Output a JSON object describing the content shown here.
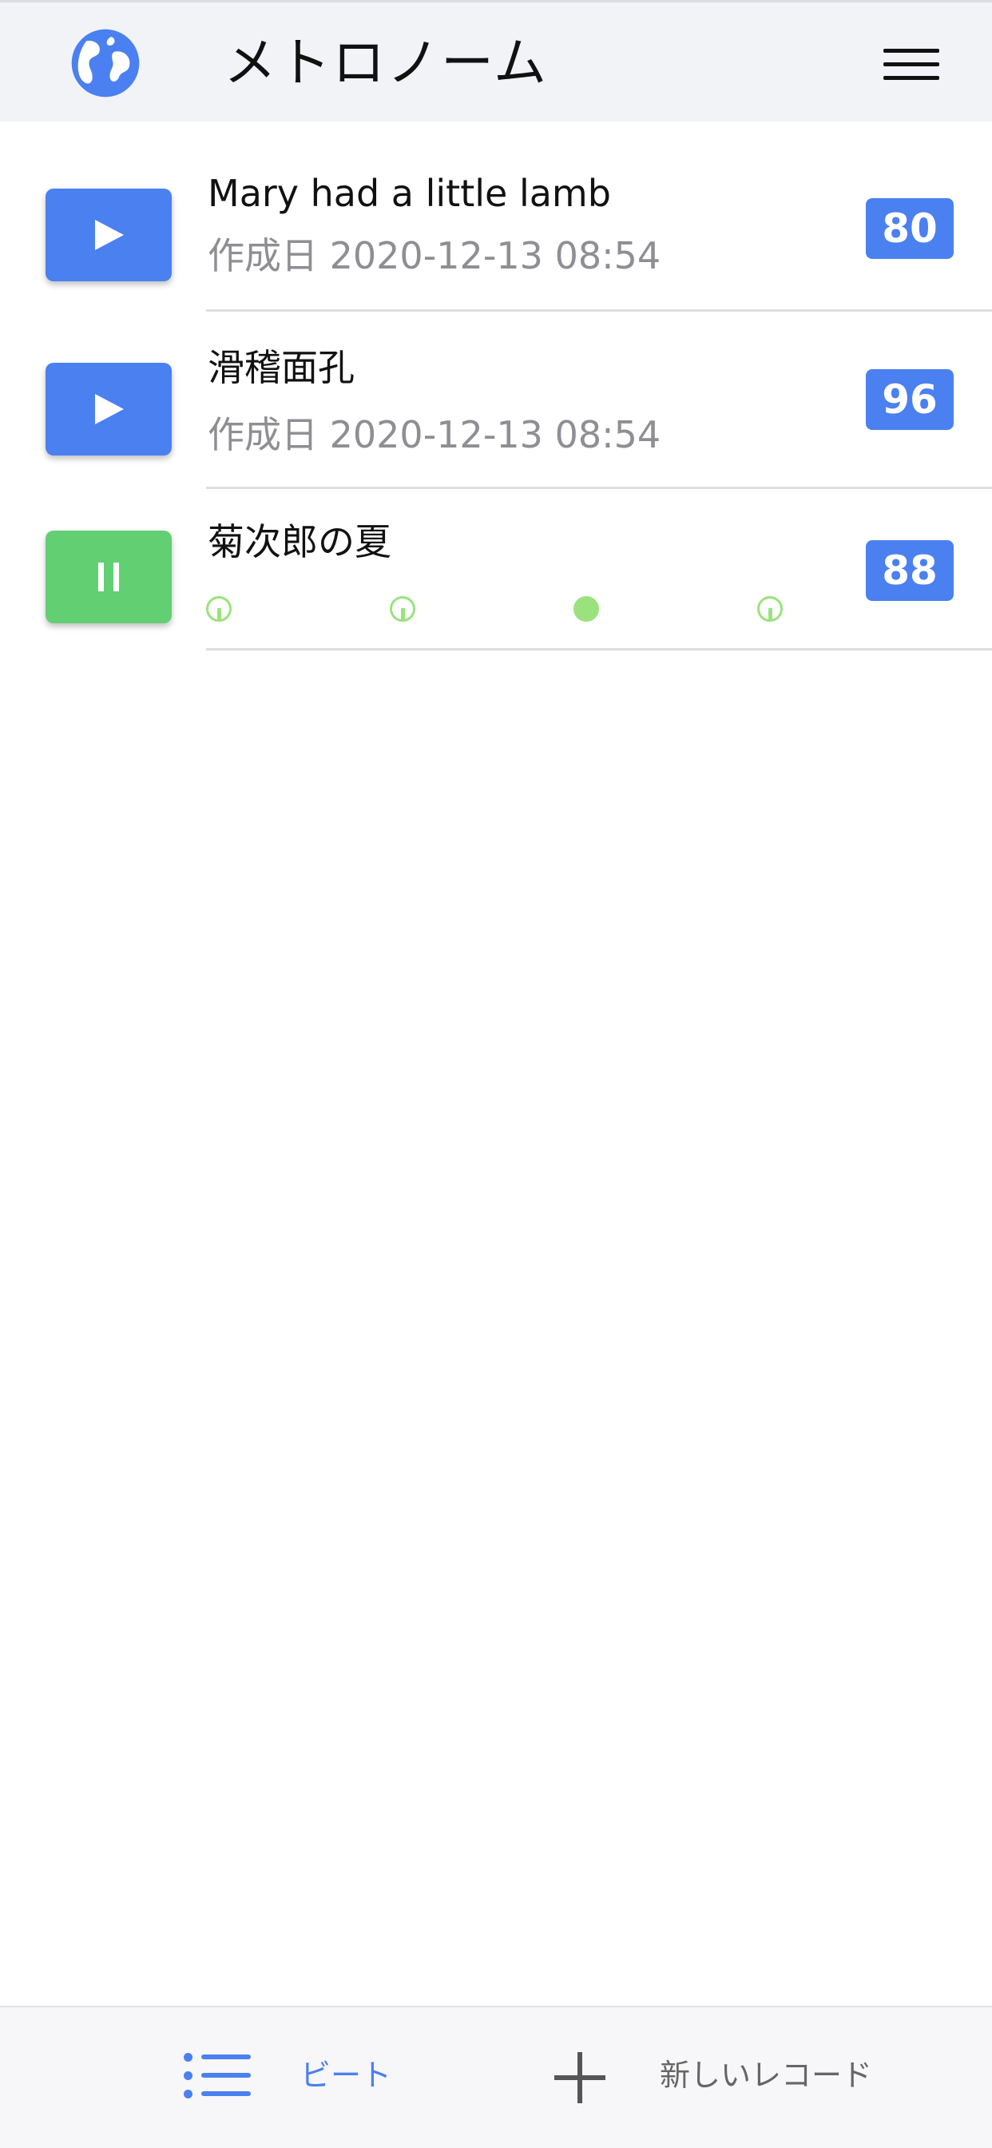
{
  "header": {
    "title": "メトロノーム",
    "globe_icon": "globe-icon",
    "menu_icon": "hamburger-menu-icon"
  },
  "records": [
    {
      "title": "Mary had a little lamb",
      "subtitle": "作成日 2020-12-13 08:54",
      "bpm": "80",
      "state": "stopped"
    },
    {
      "title": "滑稽面孔",
      "subtitle": "作成日 2020-12-13 08:54",
      "bpm": "96",
      "state": "stopped"
    },
    {
      "title": "菊次郎の夏",
      "bpm": "88",
      "state": "playing",
      "beats_per_bar": 4,
      "current_beat": 3
    }
  ],
  "bottom_nav": {
    "beats_label": "ビート",
    "new_record_label": "新しいレコード"
  },
  "colors": {
    "accent": "#4a80f0",
    "playing": "#62cf73",
    "beat": "#9be27e",
    "subtitle": "#8e8e93"
  }
}
